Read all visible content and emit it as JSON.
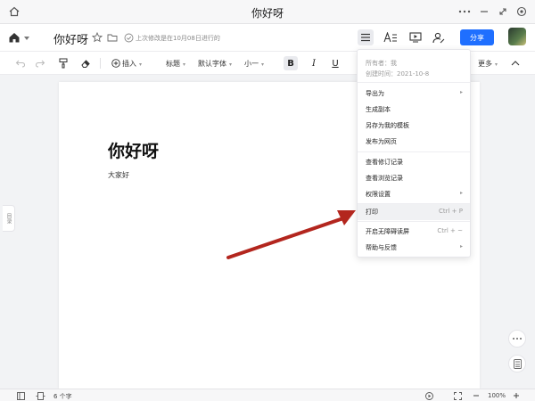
{
  "window": {
    "title": "你好呀"
  },
  "doc_toolbar": {
    "doc_title": "你好呀",
    "save_message": "上次修改是在10月08日进行的",
    "share_label": "分享"
  },
  "format_toolbar": {
    "insert_label": "插入",
    "heading_label": "标题",
    "font_label": "默认字体",
    "size_label": "小一",
    "bold_label": "B",
    "italic_label": "I",
    "underline_label": "U",
    "more_label": "更多"
  },
  "document": {
    "heading": "你好呀",
    "body": "大家好"
  },
  "outline_tab": {
    "label": "目录"
  },
  "menu": {
    "owner": "所有者：我",
    "created": "创建时间：2021-10-8",
    "items": [
      {
        "label": "导出为",
        "shortcut": "",
        "has_submenu": true
      },
      {
        "label": "生成副本",
        "shortcut": "",
        "has_submenu": false
      },
      {
        "label": "另存为我的模板",
        "shortcut": "",
        "has_submenu": false
      },
      {
        "label": "发布为网页",
        "shortcut": "",
        "has_submenu": false
      },
      {
        "label": "查看修订记录",
        "shortcut": "",
        "has_submenu": false
      },
      {
        "label": "查看浏览记录",
        "shortcut": "",
        "has_submenu": false
      },
      {
        "label": "权限设置",
        "shortcut": "",
        "has_submenu": true
      },
      {
        "label": "打印",
        "shortcut": "Ctrl + P",
        "has_submenu": false
      },
      {
        "label": "开启无障碍读屏",
        "shortcut": "Ctrl + ~",
        "has_submenu": false
      },
      {
        "label": "帮助与反馈",
        "shortcut": "",
        "has_submenu": true
      }
    ]
  },
  "status_bar": {
    "word_count": "6 个字",
    "zoom": "100%"
  },
  "colors": {
    "accent": "#1f6fff",
    "annotation_arrow": "#b3261e"
  }
}
